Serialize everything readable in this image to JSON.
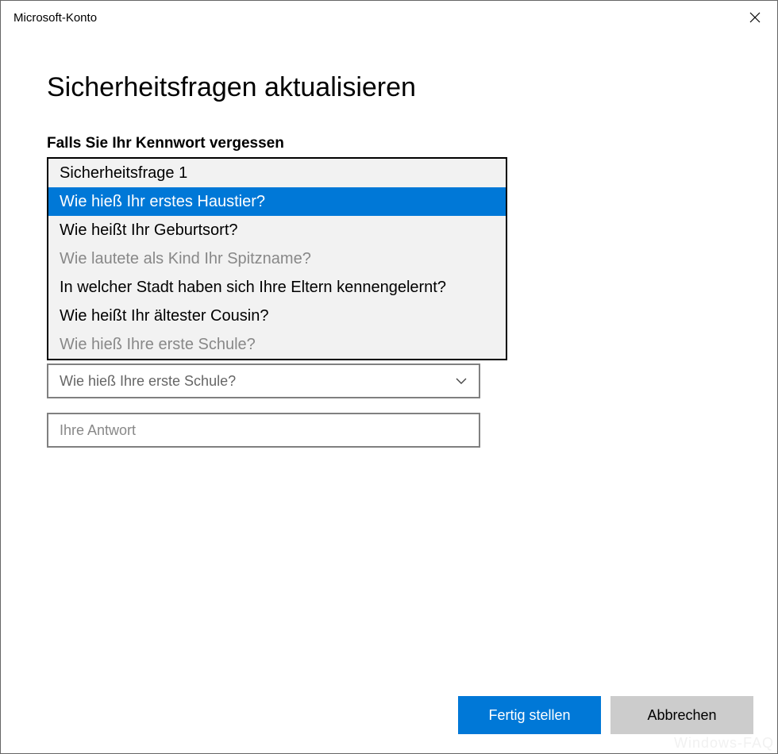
{
  "window": {
    "title": "Microsoft-Konto"
  },
  "page": {
    "heading": "Sicherheitsfragen aktualisieren",
    "subtitle": "Falls Sie Ihr Kennwort vergessen"
  },
  "dropdown1": {
    "header": "Sicherheitsfrage 1",
    "options": [
      {
        "label": "Wie hieß Ihr erstes Haustier?",
        "state": "selected"
      },
      {
        "label": "Wie heißt Ihr Geburtsort?",
        "state": "normal"
      },
      {
        "label": "Wie lautete als Kind Ihr Spitzname?",
        "state": "disabled"
      },
      {
        "label": "In welcher Stadt haben sich Ihre Eltern kennengelernt?",
        "state": "normal"
      },
      {
        "label": "Wie heißt Ihr ältester Cousin?",
        "state": "normal"
      },
      {
        "label": "Wie hieß Ihre erste Schule?",
        "state": "disabled"
      }
    ]
  },
  "answer_placeholder": "Ihre Antwort",
  "question3_selected": "Wie hieß Ihre erste Schule?",
  "buttons": {
    "primary": "Fertig stellen",
    "secondary": "Abbrechen"
  },
  "watermark": "Windows-FAQ"
}
